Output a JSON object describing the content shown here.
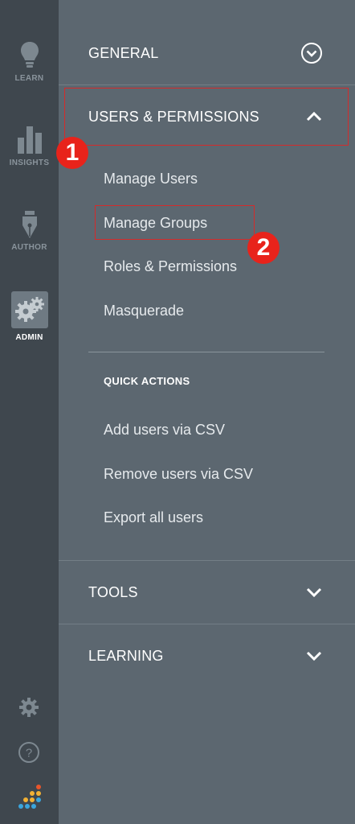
{
  "rail": {
    "items": [
      {
        "label": "LEARN",
        "icon": "lightbulb-icon"
      },
      {
        "label": "INSIGHTS",
        "icon": "bar-chart-icon"
      },
      {
        "label": "AUTHOR",
        "icon": "pen-nib-icon"
      },
      {
        "label": "ADMIN",
        "icon": "gears-icon",
        "active": true
      }
    ],
    "bottom_icons": [
      "gear-icon",
      "help-icon",
      "dots-logo-icon"
    ]
  },
  "panel": {
    "general": {
      "label": "GENERAL",
      "icon": "chevron-down-circle-icon"
    },
    "users_permissions": {
      "label": "USERS & PERMISSIONS",
      "icon": "chevron-up-icon",
      "items": [
        "Manage Users",
        "Manage Groups",
        "Roles & Permissions",
        "Masquerade"
      ],
      "quick_actions_title": "QUICK ACTIONS",
      "quick_actions": [
        "Add users via CSV",
        "Remove users via CSV",
        "Export all users"
      ]
    },
    "tools": {
      "label": "TOOLS",
      "icon": "chevron-down-icon"
    },
    "learning": {
      "label": "LEARNING",
      "icon": "chevron-down-icon"
    }
  },
  "annotations": {
    "step1": "1",
    "step2": "2"
  },
  "colors": {
    "rail_bg": "#3f474e",
    "panel_bg": "#5c6770",
    "highlight": "#d42b2b",
    "badge": "#e8231b"
  }
}
